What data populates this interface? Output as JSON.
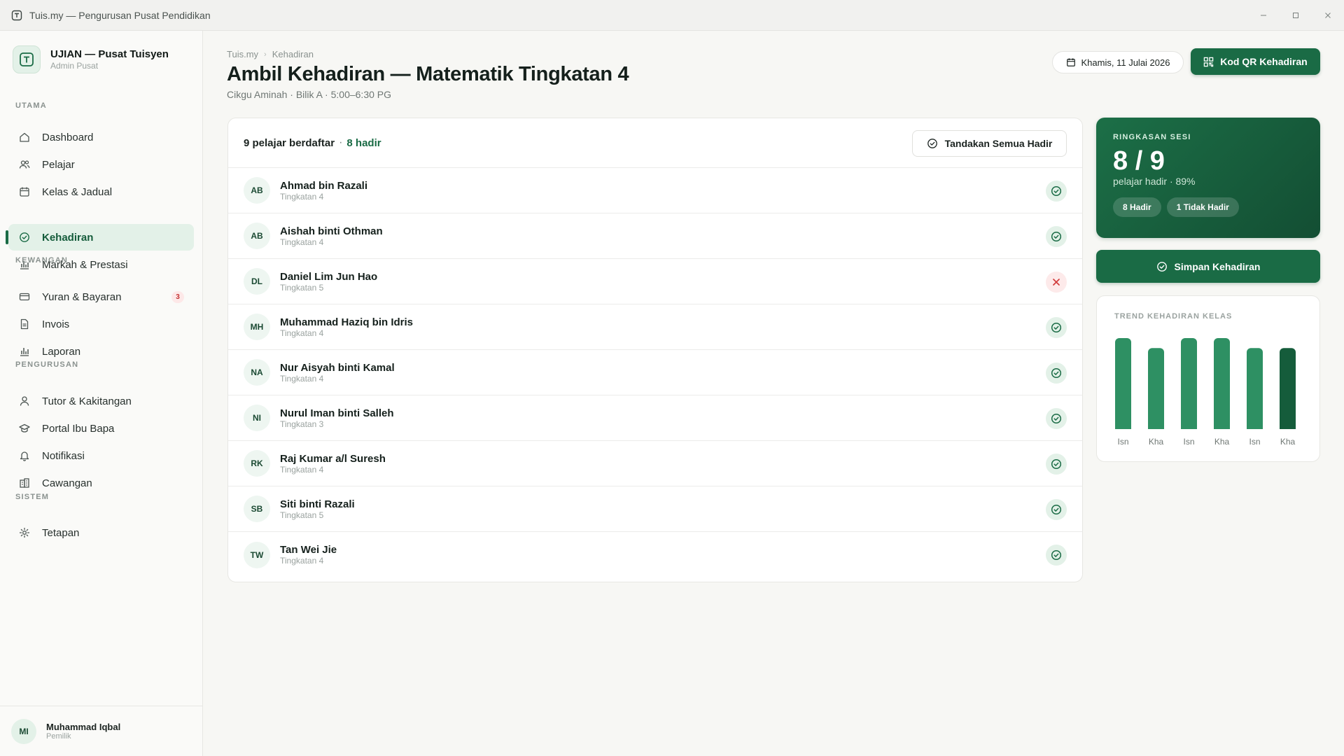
{
  "window": {
    "title": "Tuis.my — Pengurusan Pusat Pendidikan"
  },
  "brand": {
    "name": "UJIAN — Pusat Tuisyen",
    "role": "Admin Pusat"
  },
  "nav": {
    "sections": [
      "UTAMA",
      "KEWANGAN",
      "PENGURUSAN",
      "SISTEM"
    ],
    "items": [
      {
        "label": "Dashboard",
        "icon": "home-icon"
      },
      {
        "label": "Pelajar",
        "icon": "users-icon"
      },
      {
        "label": "Kelas & Jadual",
        "icon": "calendar-icon"
      },
      {
        "label": "Kehadiran",
        "icon": "check-circle-icon",
        "active": true
      },
      {
        "label": "Markah & Prestasi",
        "icon": "bar-chart-icon"
      },
      {
        "label": "Yuran & Bayaran",
        "icon": "credit-card-icon",
        "badge": "3"
      },
      {
        "label": "Invois",
        "icon": "file-icon"
      },
      {
        "label": "Laporan",
        "icon": "bar-chart-icon"
      },
      {
        "label": "Tutor & Kakitangan",
        "icon": "user-icon"
      },
      {
        "label": "Portal Ibu Bapa",
        "icon": "graduation-cap-icon"
      },
      {
        "label": "Notifikasi",
        "icon": "bell-icon"
      },
      {
        "label": "Cawangan",
        "icon": "building-icon"
      },
      {
        "label": "Tetapan",
        "icon": "gear-icon"
      }
    ]
  },
  "user": {
    "initials": "MI",
    "name": "Muhammad Iqbal",
    "role": "Pemilik"
  },
  "breadcrumb": [
    "Tuis.my",
    "Kehadiran"
  ],
  "page": {
    "title": "Ambil Kehadiran — Matematik Tingkatan 4",
    "subtitle": "Cikgu Aminah · Bilik A · 5:00–6:30 PG"
  },
  "header": {
    "date": "Khamis, 11 Julai 2026",
    "qr_label": "Kod QR Kehadiran"
  },
  "list": {
    "count_text": "9 pelajar berdaftar",
    "present_text": "8 hadir",
    "mark_all_label": "Tandakan Semua Hadir",
    "students": [
      {
        "initials": "AB",
        "name": "Ahmad bin Razali",
        "level": "Tingkatan 4",
        "present": true
      },
      {
        "initials": "AB",
        "name": "Aishah binti Othman",
        "level": "Tingkatan 4",
        "present": true
      },
      {
        "initials": "DL",
        "name": "Daniel Lim Jun Hao",
        "level": "Tingkatan 5",
        "present": false
      },
      {
        "initials": "MH",
        "name": "Muhammad Haziq bin Idris",
        "level": "Tingkatan 4",
        "present": true
      },
      {
        "initials": "NA",
        "name": "Nur Aisyah binti Kamal",
        "level": "Tingkatan 4",
        "present": true
      },
      {
        "initials": "NI",
        "name": "Nurul Iman binti Salleh",
        "level": "Tingkatan 3",
        "present": true
      },
      {
        "initials": "RK",
        "name": "Raj Kumar a/l Suresh",
        "level": "Tingkatan 4",
        "present": true
      },
      {
        "initials": "SB",
        "name": "Siti binti Razali",
        "level": "Tingkatan 5",
        "present": true
      },
      {
        "initials": "TW",
        "name": "Tan Wei Jie",
        "level": "Tingkatan 4",
        "present": true
      }
    ]
  },
  "summary": {
    "label": "RINGKASAN SESI",
    "big": "8 / 9",
    "sub": "pelajar hadir · 89%",
    "chip_present": "8 Hadir",
    "chip_absent": "1 Tidak Hadir"
  },
  "save_label": "Simpan Kehadiran",
  "trend": {
    "title": "TREND KEHADIRAN KELAS"
  },
  "chart_data": {
    "type": "bar",
    "title": "TREND KEHADIRAN KELAS",
    "categories": [
      "Isn",
      "Kha",
      "Isn",
      "Kha",
      "Isn",
      "Kha"
    ],
    "values": [
      100,
      89,
      100,
      100,
      89,
      89
    ],
    "ylim": [
      0,
      100
    ],
    "grid": false,
    "colors": [
      "#2e9063",
      "#2e9063",
      "#2e9063",
      "#2e9063",
      "#2e9063",
      "#155c3b"
    ]
  },
  "colors": {
    "accent": "#1a6b45",
    "accent_light": "#e3f1e8",
    "danger": "#d13b3b"
  }
}
